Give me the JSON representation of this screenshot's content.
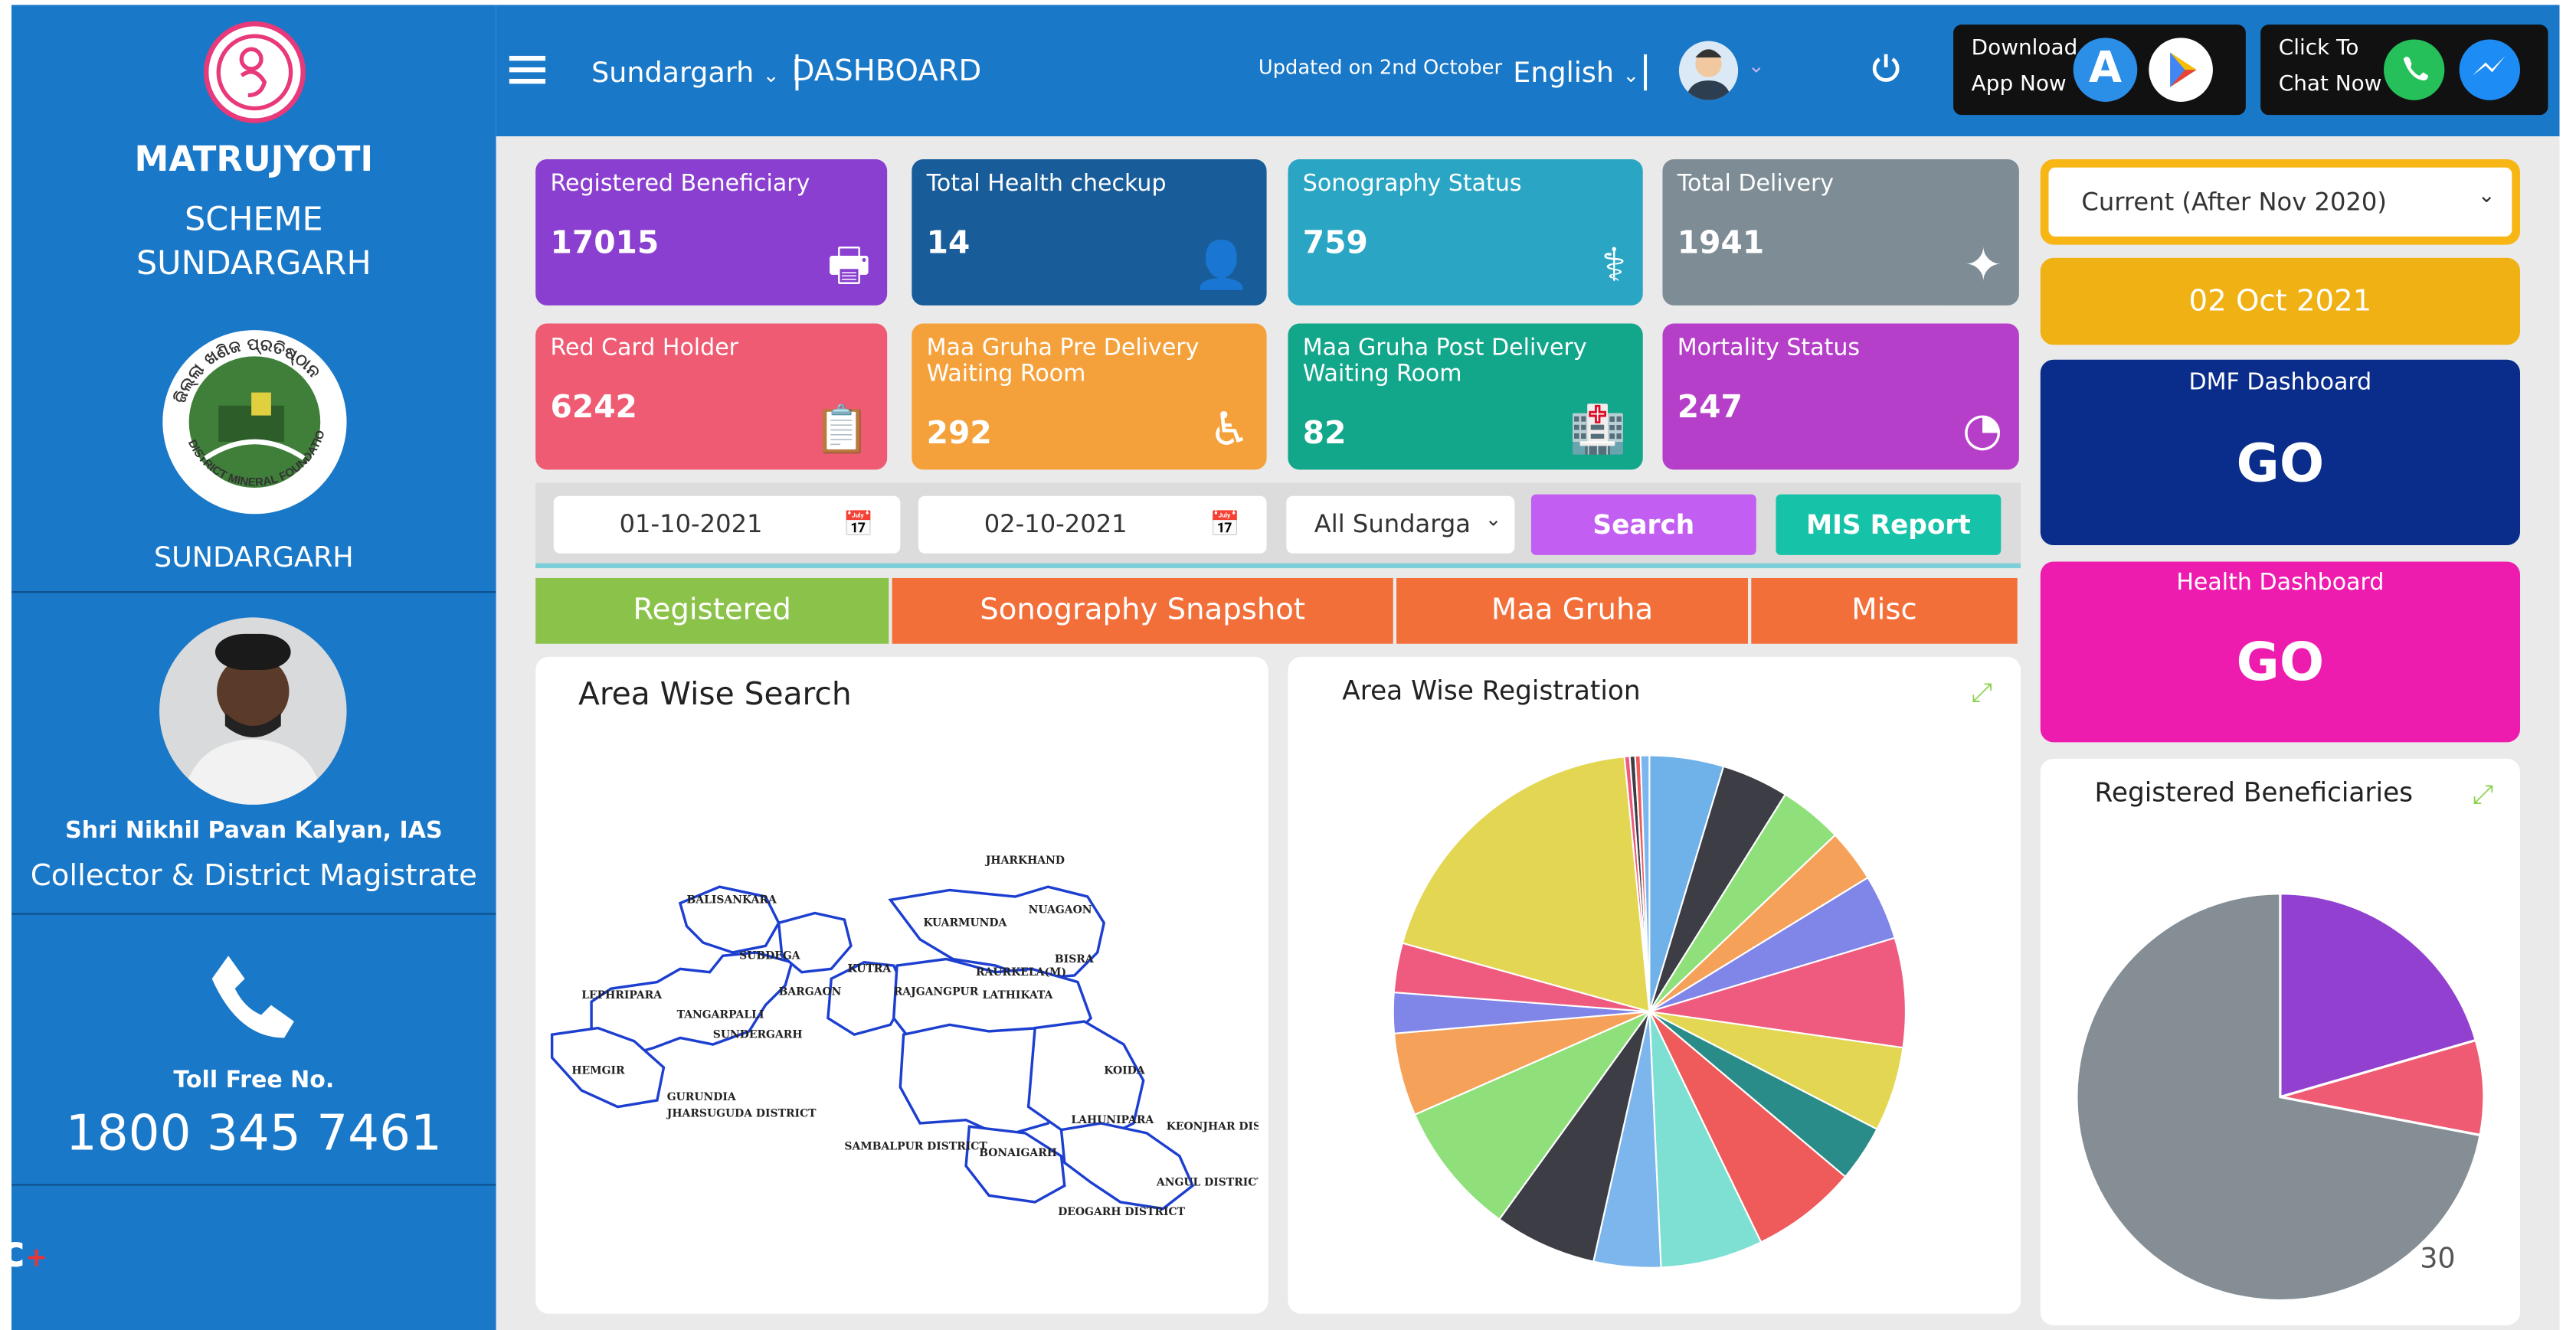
{
  "sidebar": {
    "title": "MATRUJYOTI",
    "scheme_line1": "SCHEME",
    "scheme_line2": "SUNDARGARH",
    "dmf_text_top": "ଜିଲ୍ଲା ଖଣିଜ ପ୍ରତିଷ୍ଠାନ",
    "dmf_text_bottom": "DISTRICT MINERAL FOUNDATION",
    "district": "SUNDARGARH",
    "officer_name": "Shri Nikhil Pavan Kalyan, IAS",
    "officer_title": "Collector & District Magistrate",
    "toll_free_label": "Toll Free No.",
    "toll_free_number": "1800 345 7461"
  },
  "topbar": {
    "district_select": "Sundargarh",
    "section_title": "DASHBOARD",
    "updated": "Updated on 2nd October",
    "language": "English",
    "download_line1": "Download",
    "download_line2": "App Now",
    "chat_line1": "Click To",
    "chat_line2": "Chat Now"
  },
  "cards": [
    {
      "label": "Registered Beneficiary",
      "value": "17015",
      "icon": "cash-register-icon",
      "color": "#8a3fd0"
    },
    {
      "label": "Total Health checkup",
      "value": "14",
      "icon": "id-badge-icon",
      "color": "#185c9a"
    },
    {
      "label": "Sonography Status",
      "value": "759",
      "icon": "doctor-icon",
      "color": "#2aa6c4"
    },
    {
      "label": "Total Delivery",
      "value": "1941",
      "icon": "child-icon",
      "color": "#7e8c95"
    },
    {
      "label": "Red Card Holder",
      "value": "6242",
      "icon": "id-card-icon",
      "color": "#ef5b72"
    },
    {
      "label": "Maa Gruha Pre Delivery Waiting Room",
      "value": "292",
      "icon": "wheelchair-icon",
      "color": "#f5a13b"
    },
    {
      "label": "Maa Gruha Post Delivery Waiting Room",
      "value": "82",
      "icon": "hospital-icon",
      "color": "#12a68a"
    },
    {
      "label": "Mortality Status",
      "value": "247",
      "icon": "globe-icon",
      "color": "#b53fc9"
    }
  ],
  "filters": {
    "date_from": "01-10-2021",
    "date_to": "02-10-2021",
    "area_select": "All Sundarga",
    "search_label": "Search",
    "mis_label": "MIS Report"
  },
  "tabs": [
    "Registered",
    "Sonography Snapshot",
    "Maa Gruha",
    "Misc"
  ],
  "map_panel": {
    "title": "Area Wise Search",
    "labels": [
      "JHARKHAND",
      "NUAGAON",
      "BALISANKARA",
      "KUARMUNDA",
      "SUBDEGA",
      "BISRA",
      "KUTRA",
      "LEPHRIPARA",
      "TANGARPALLI",
      "BARGAON",
      "RAJGANGPUR",
      "LATHIKATA",
      "KUTRA",
      "SUNDERGARH",
      "HEMGIR",
      "GURUNDIA",
      "KOIDA",
      "JHARSUGUDA DISTRICT",
      "LAHUNIPARA",
      "KEONJHAR DISTRICT",
      "SAMBALPUR DISTRICT",
      "BONAIGARH",
      "ANGUL DISTRICT",
      "DEOGARH DISTRICT",
      "RAURKELA(M)"
    ]
  },
  "pie_panel": {
    "title": "Area Wise Registration"
  },
  "right": {
    "period_select": "Current (After Nov 2020)",
    "date": "02 Oct 2021",
    "dmf_title": "DMF Dashboard",
    "dmf_go": "GO",
    "health_title": "Health Dashboard",
    "health_go": "GO",
    "reg_title": "Registered Beneficiaries",
    "page_number": "30"
  },
  "chart_data": [
    {
      "type": "pie",
      "title": "Area Wise Registration",
      "colors": [
        "#6fb2ea",
        "#3d3d45",
        "#8fe07a",
        "#f5a15a",
        "#8085e8",
        "#ef5b7e",
        "#e2d653",
        "#2a8c88",
        "#ef5a5a",
        "#7de0d2",
        "#7db6ec",
        "#3d3d45",
        "#8fe07a",
        "#f5a15a",
        "#8085e8",
        "#ef5b7e",
        "#e2d653",
        "#ef5b7e",
        "#3d3d45",
        "#ef5a5a",
        "#7db6ec"
      ],
      "values": [
        4.2,
        3.8,
        3.6,
        3.0,
        3.7,
        6.2,
        4.8,
        3.2,
        6.0,
        5.8,
        3.8,
        5.8,
        7.6,
        4.7,
        2.3,
        2.8,
        17.2,
        0.3,
        0.3,
        0.3,
        0.5
      ]
    },
    {
      "type": "pie",
      "title": "Registered Beneficiaries",
      "colors": [
        "#9140d0",
        "#ef5b72",
        "#848e94"
      ],
      "values": [
        20.5,
        7.5,
        72
      ]
    }
  ]
}
